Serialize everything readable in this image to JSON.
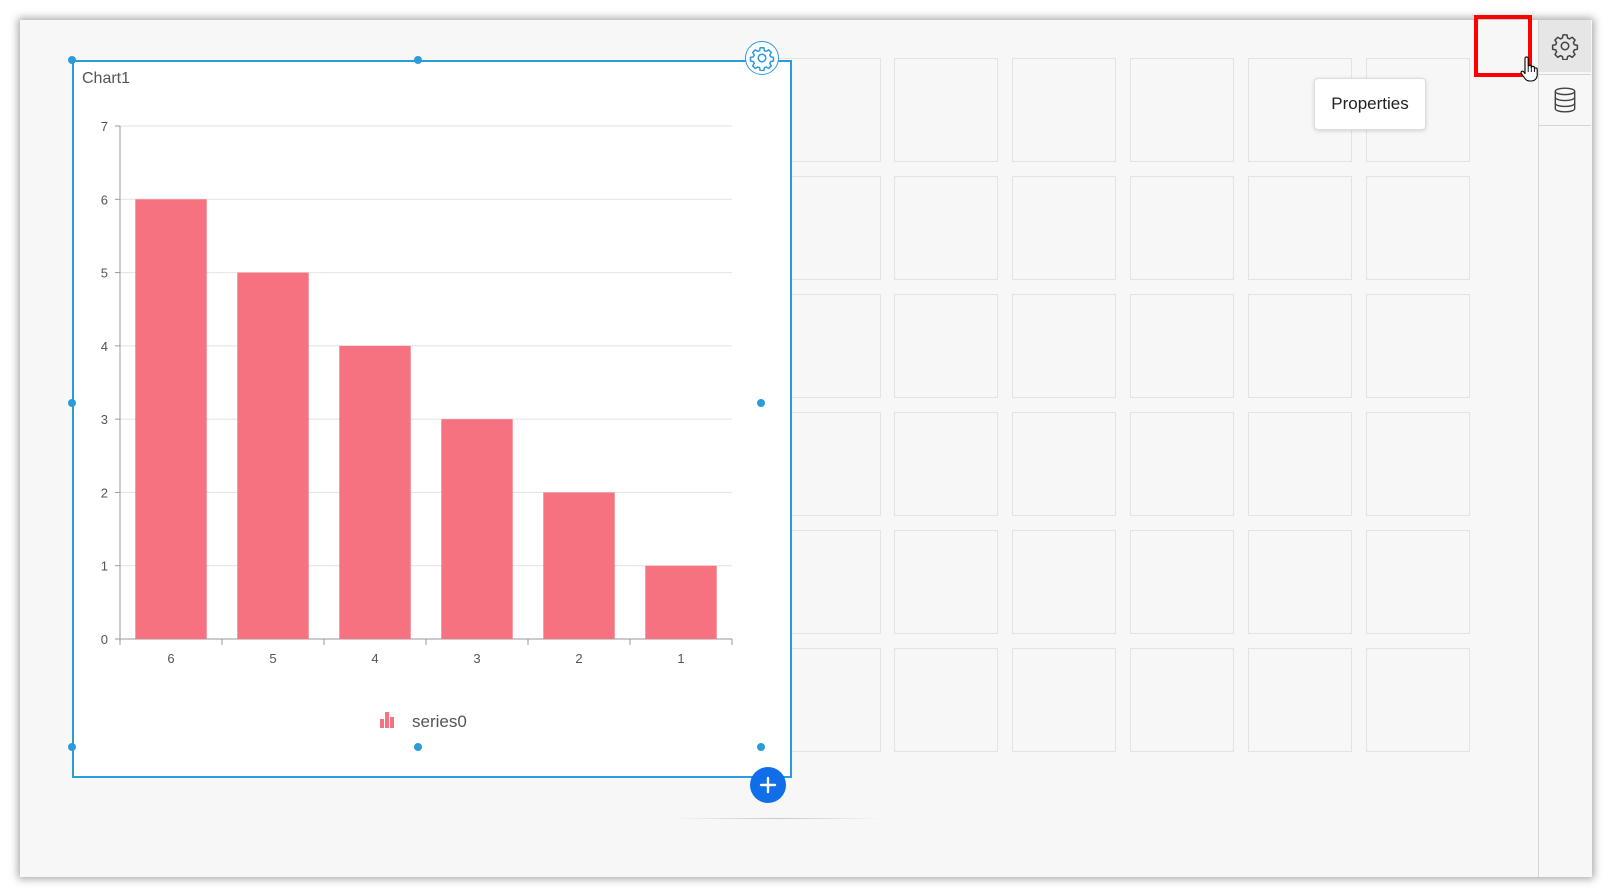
{
  "widget": {
    "title": "Chart1"
  },
  "tooltip": {
    "text": "Properties"
  },
  "panel": {
    "properties_icon": "gear-icon",
    "data_source_icon": "database-icon"
  },
  "colors": {
    "widget_border": "#2b9cdb",
    "bar_fill": "#f67280",
    "add_button": "#0f6ee8",
    "highlight": "#ff0000"
  },
  "chart_data": {
    "type": "bar",
    "categories": [
      "6",
      "5",
      "4",
      "3",
      "2",
      "1"
    ],
    "series": [
      {
        "name": "series0",
        "values": [
          6,
          5,
          4,
          3,
          2,
          1
        ]
      }
    ],
    "title": "Chart1",
    "xlabel": "",
    "ylabel": "",
    "ylim": [
      0,
      7
    ],
    "yticks": [
      "0",
      "1",
      "2",
      "3",
      "4",
      "5",
      "6",
      "7"
    ],
    "grid": true,
    "legend": "bottom-center"
  }
}
